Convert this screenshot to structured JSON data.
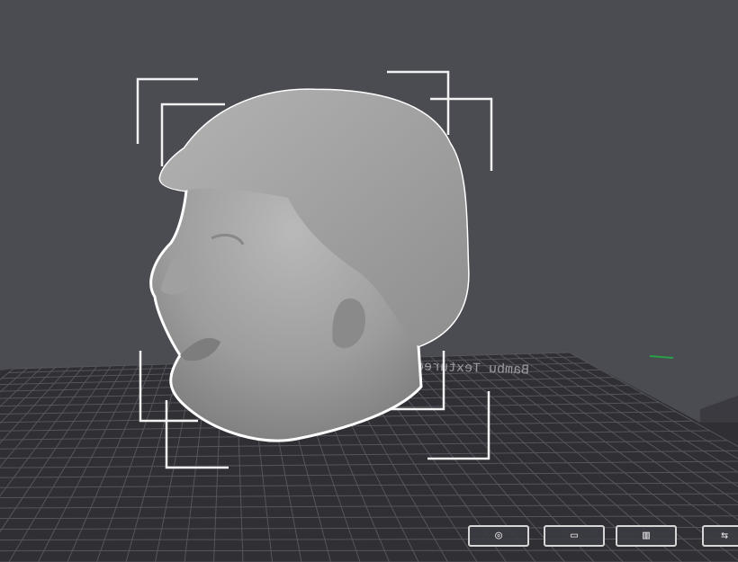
{
  "plate": {
    "label": "Bambu Textured PEI Plate",
    "label_color": "#9a9aa0",
    "grid_color": "#5a5a62",
    "plate_color": "#2e2e33"
  },
  "model": {
    "name": "head-model",
    "selection_color": "#ffffff",
    "body_color": "#a8a8a8"
  },
  "toolbar": {
    "view_icon": "camera-icon",
    "layer_icon": "object-icon",
    "stats_icon": "stats-icon",
    "more_icon": "more-icon"
  },
  "colors": {
    "background": "#4b4b52",
    "axis_green": "#27a046"
  }
}
